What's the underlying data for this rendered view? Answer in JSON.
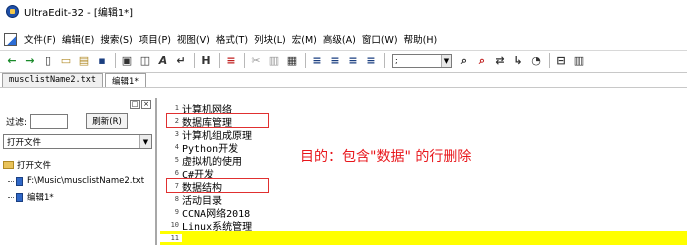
{
  "window": {
    "title": "UltraEdit-32 - [编辑1*]"
  },
  "menu": {
    "items": [
      {
        "label": "文件(F)"
      },
      {
        "label": "编辑(E)"
      },
      {
        "label": "搜索(S)"
      },
      {
        "label": "项目(P)"
      },
      {
        "label": "视图(V)"
      },
      {
        "label": "格式(T)"
      },
      {
        "label": "列块(L)"
      },
      {
        "label": "宏(M)"
      },
      {
        "label": "高级(A)"
      },
      {
        "label": "窗口(W)"
      },
      {
        "label": "帮助(H)"
      }
    ]
  },
  "toolbar": {
    "font_combo_value": ";",
    "buttons": [
      {
        "icon": "back-arrow-icon",
        "glyph": "←"
      },
      {
        "icon": "forward-arrow-icon",
        "glyph": "→"
      },
      {
        "icon": "new-file-icon",
        "glyph": "▯"
      },
      {
        "icon": "open-folder-icon",
        "glyph": "▭"
      },
      {
        "icon": "open-file-icon",
        "glyph": "▤"
      },
      {
        "icon": "save-icon",
        "glyph": "▪"
      },
      {
        "icon": "print-icon",
        "glyph": "▣"
      },
      {
        "icon": "print-preview-icon",
        "glyph": "◫"
      },
      {
        "icon": "font-icon",
        "glyph": "A"
      },
      {
        "icon": "word-wrap-icon",
        "glyph": "↵"
      },
      {
        "icon": "hex-icon",
        "glyph": "H"
      },
      {
        "icon": "line-numbers-icon",
        "glyph": "≡"
      },
      {
        "icon": "cut-icon",
        "glyph": "✂"
      },
      {
        "icon": "copy-icon",
        "glyph": "▥"
      },
      {
        "icon": "paste-icon",
        "glyph": "▦"
      },
      {
        "icon": "align-left-icon",
        "glyph": "≡"
      },
      {
        "icon": "align-center-icon",
        "glyph": "≡"
      },
      {
        "icon": "align-right-icon",
        "glyph": "≡"
      },
      {
        "icon": "justify-icon",
        "glyph": "≡"
      },
      {
        "icon": "find-icon",
        "glyph": "⌕"
      },
      {
        "icon": "find-in-files-icon",
        "glyph": "⌕"
      },
      {
        "icon": "replace-icon",
        "glyph": "⇄"
      },
      {
        "icon": "goto-icon",
        "glyph": "↳"
      },
      {
        "icon": "browser-icon",
        "glyph": "◔"
      },
      {
        "icon": "split-window-icon",
        "glyph": "⊟"
      },
      {
        "icon": "column-mode-icon",
        "glyph": "▥"
      }
    ]
  },
  "tabs": [
    {
      "label": "musclistName2.txt"
    },
    {
      "label": "编辑1*"
    }
  ],
  "side_panel": {
    "filter_label": "过滤:",
    "filter_value": "",
    "refresh_label": "刷新(R)",
    "select_value": "打开文件",
    "tree_root": "打开文件",
    "tree_items": [
      {
        "label": "F:\\Music\\musclistName2.txt"
      },
      {
        "label": "编辑1*"
      }
    ]
  },
  "editor": {
    "lines": [
      {
        "num": "1",
        "text": "计算机网络"
      },
      {
        "num": "2",
        "text": "数据库管理"
      },
      {
        "num": "3",
        "text": "计算机组成原理"
      },
      {
        "num": "4",
        "text": "Python开发"
      },
      {
        "num": "5",
        "text": "虚拟机的使用"
      },
      {
        "num": "6",
        "text": "C#开发"
      },
      {
        "num": "7",
        "text": "数据结构"
      },
      {
        "num": "8",
        "text": "活动目录"
      },
      {
        "num": "9",
        "text": "CCNA网络2018"
      },
      {
        "num": "10",
        "text": "Linux系统管理"
      },
      {
        "num": "11",
        "text": ""
      }
    ],
    "current_line": 11,
    "highlight_color": "#ffff00"
  },
  "annotation": {
    "text": "目的：包含\"数据\" 的行删除",
    "color": "#e8161b"
  }
}
